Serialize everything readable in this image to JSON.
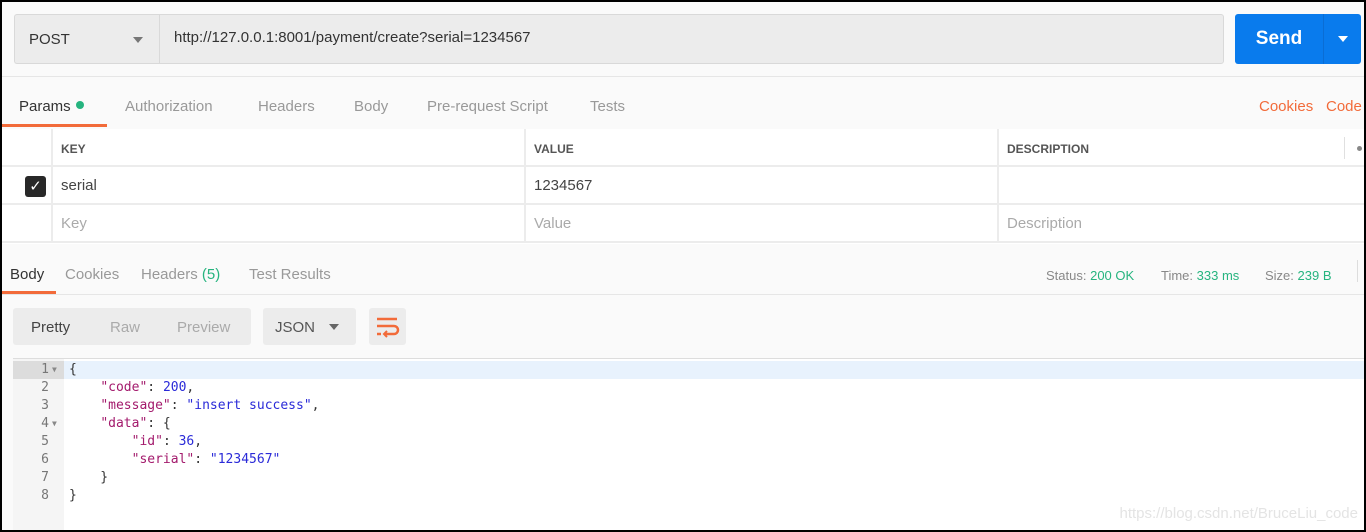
{
  "request": {
    "method": "POST",
    "url": "http://127.0.0.1:8001/payment/create?serial=1234567",
    "send_label": "Send"
  },
  "request_tabs": [
    {
      "label": "Params",
      "active": true,
      "indicator": "green-dot"
    },
    {
      "label": "Authorization"
    },
    {
      "label": "Headers"
    },
    {
      "label": "Body"
    },
    {
      "label": "Pre-request Script"
    },
    {
      "label": "Tests"
    }
  ],
  "request_links": {
    "cookies": "Cookies",
    "code": "Code"
  },
  "params": {
    "headers": {
      "key": "KEY",
      "value": "VALUE",
      "description": "DESCRIPTION"
    },
    "rows": [
      {
        "checked": true,
        "key": "serial",
        "value": "1234567",
        "description": ""
      }
    ],
    "placeholders": {
      "key": "Key",
      "value": "Value",
      "description": "Description"
    }
  },
  "response_tabs": {
    "body": "Body",
    "cookies": "Cookies",
    "headers": "Headers",
    "headers_count": "(5)",
    "test_results": "Test Results"
  },
  "response_meta": {
    "status_label": "Status:",
    "status_value": "200 OK",
    "time_label": "Time:",
    "time_value": "333 ms",
    "size_label": "Size:",
    "size_value": "239 B"
  },
  "view_options": {
    "pretty": "Pretty",
    "raw": "Raw",
    "preview": "Preview",
    "format": "JSON"
  },
  "response_body": {
    "lines": [
      "1",
      "2",
      "3",
      "4",
      "5",
      "6",
      "7",
      "8"
    ],
    "code": {
      "code": 200,
      "message": "insert success",
      "id": 36,
      "serial": "1234567"
    }
  },
  "colors": {
    "accent": "#f26b3a",
    "send": "#097bed",
    "success": "#26b47f"
  },
  "watermark": "https://blog.csdn.net/BruceLiu_code"
}
